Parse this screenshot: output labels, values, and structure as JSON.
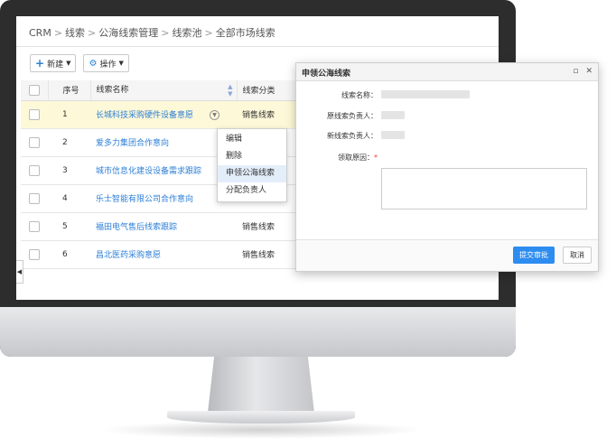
{
  "breadcrumb": [
    "CRM",
    "线索",
    "公海线索管理",
    "线索池",
    "全部市场线索"
  ],
  "breadcrumb_separator": ">",
  "toolbar": {
    "new_label": "新建",
    "action_label": "操作"
  },
  "table": {
    "headers": {
      "index": "序号",
      "name": "线索名称",
      "category": "线索分类"
    },
    "rows": [
      {
        "index": "1",
        "name": "长城科技采购硬件设备意愿",
        "category": "销售线索"
      },
      {
        "index": "2",
        "name": "爱多力集团合作意向",
        "category": ""
      },
      {
        "index": "3",
        "name": "城市信息化建设设备需求跟踪",
        "category": ""
      },
      {
        "index": "4",
        "name": "乐士智能有限公司合作意向",
        "category": ""
      },
      {
        "index": "5",
        "name": "福田电气售后线索跟踪",
        "category": "销售线索"
      },
      {
        "index": "6",
        "name": "昌北医药采购意愿",
        "category": "销售线索"
      }
    ]
  },
  "context_menu": {
    "items": [
      "编辑",
      "删除",
      "申领公海线索",
      "分配负责人"
    ],
    "active_item": "申领公海线索"
  },
  "dialog": {
    "title": "申领公海线索",
    "fields": {
      "lead_name": "线索名称：",
      "original_owner": "原线索负责人：",
      "new_owner": "新线索负责人：",
      "reason": "领取原因："
    },
    "required_marker": "*",
    "submit_label": "提交审批",
    "cancel_label": "取消"
  },
  "colors": {
    "link": "#2d7fd6",
    "primary_button": "#2d8cf0",
    "highlight_row": "#fdf8d8",
    "required": "#e53935"
  },
  "icons": [
    "plus-icon",
    "gear-icon",
    "caret-down-icon",
    "sort-icon",
    "row-menu-icon",
    "collapse-arrow-icon",
    "maximize-icon",
    "close-icon"
  ]
}
